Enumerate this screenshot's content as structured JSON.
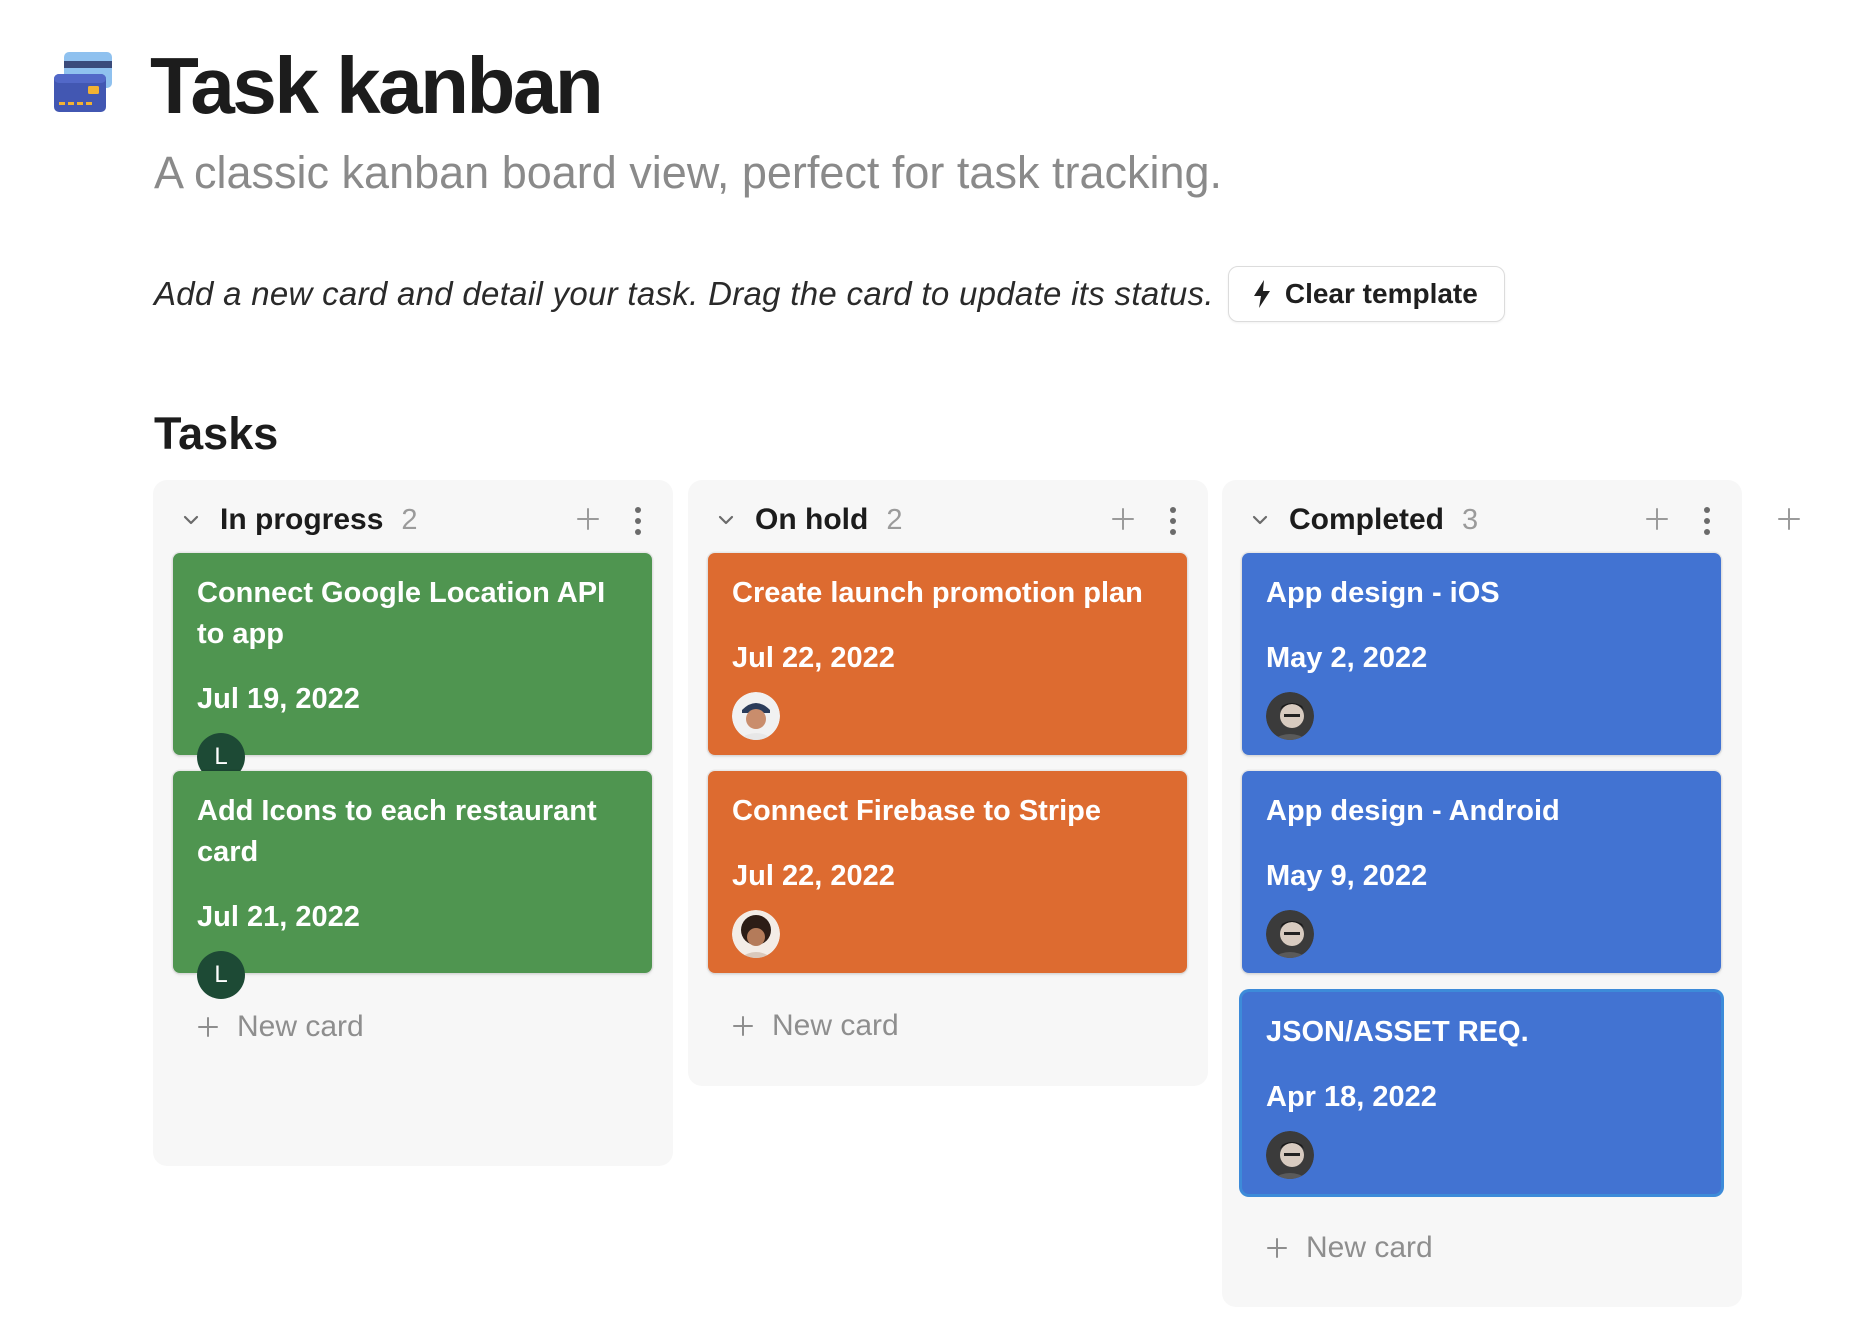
{
  "page": {
    "title": "Task kanban",
    "subtitle": "A classic kanban board view, perfect for task tracking.",
    "instruction": "Add a new card and detail your task. Drag the card to update its status.",
    "clear_template_label": "Clear template",
    "icon": "credit-card-icon"
  },
  "board": {
    "title": "Tasks",
    "new_card_label": "New card",
    "columns": [
      {
        "name": "In progress",
        "count": "2",
        "color": "#4f9550",
        "cards": [
          {
            "title": "Connect Google Location API to app",
            "date": "Jul 19, 2022",
            "assignee_initial": "L"
          },
          {
            "title": "Add Icons to each restaurant card",
            "date": "Jul 21, 2022",
            "assignee_initial": "L"
          }
        ]
      },
      {
        "name": "On hold",
        "count": "2",
        "color": "#dd6b30",
        "cards": [
          {
            "title": "Create launch promotion plan",
            "date": "Jul 22, 2022",
            "assignee": "avatar-photo"
          },
          {
            "title": "Connect Firebase to Stripe",
            "date": "Jul 22, 2022",
            "assignee": "avatar-photo"
          }
        ]
      },
      {
        "name": "Completed",
        "count": "3",
        "color": "#4273d2",
        "cards": [
          {
            "title": "App design - iOS",
            "date": "May 2, 2022",
            "assignee": "avatar-photo"
          },
          {
            "title": "App design - Android",
            "date": "May 9, 2022",
            "assignee": "avatar-photo"
          },
          {
            "title": "JSON/ASSET REQ.",
            "date": "Apr 18, 2022",
            "assignee": "avatar-photo"
          }
        ]
      }
    ]
  }
}
